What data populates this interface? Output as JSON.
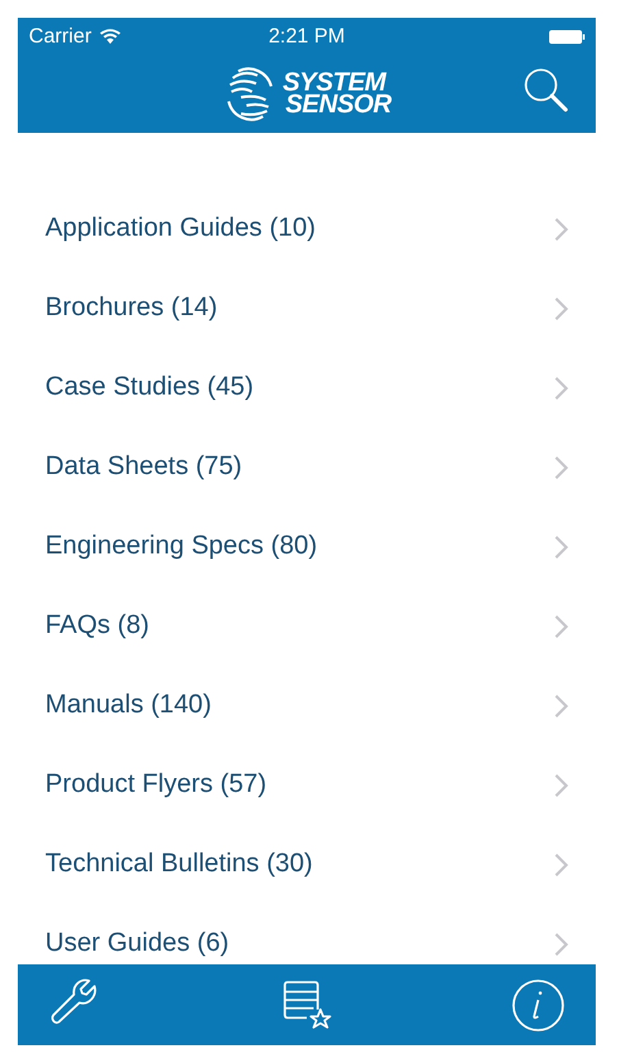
{
  "status_bar": {
    "carrier": "Carrier",
    "time": "2:21 PM"
  },
  "nav_bar": {
    "logo_line_1": "SYSTEM",
    "logo_line_2": "SENSOR"
  },
  "list": [
    {
      "label": "Application Guides (10)"
    },
    {
      "label": "Brochures (14)"
    },
    {
      "label": "Case Studies (45)"
    },
    {
      "label": "Data Sheets (75)"
    },
    {
      "label": "Engineering Specs (80)"
    },
    {
      "label": "FAQs (8)"
    },
    {
      "label": "Manuals (140)"
    },
    {
      "label": "Product Flyers (57)"
    },
    {
      "label": "Technical Bulletins (30)"
    },
    {
      "label": "User Guides (6)"
    }
  ],
  "tab_bar": [
    {
      "kind": "tools"
    },
    {
      "kind": "favorites"
    },
    {
      "kind": "info"
    }
  ]
}
